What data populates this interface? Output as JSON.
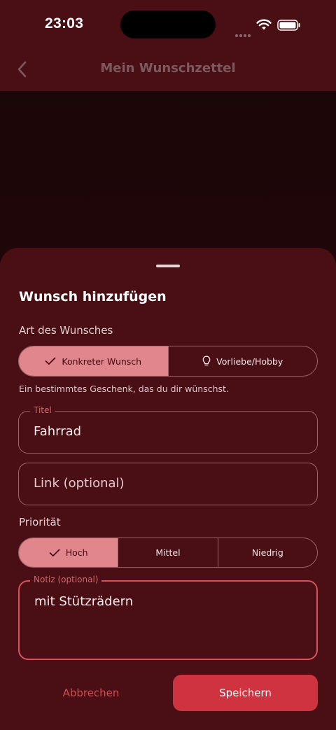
{
  "status": {
    "time": "23:03"
  },
  "nav": {
    "title": "Mein Wunschzettel"
  },
  "sheet": {
    "title": "Wunsch hinzufügen",
    "type_label": "Art des Wunsches",
    "type_options": [
      {
        "label": "Konkreter Wunsch",
        "selected": true,
        "icon": "check-icon"
      },
      {
        "label": "Vorliebe/Hobby",
        "selected": false,
        "icon": "lightbulb-icon"
      }
    ],
    "type_helper": "Ein bestimmtes Geschenk, das du dir wünschst.",
    "title_field": {
      "label": "Titel",
      "value": "Fahrrad"
    },
    "link_field": {
      "placeholder": "Link (optional)"
    },
    "priority_label": "Priorität",
    "priority_options": [
      {
        "label": "Hoch",
        "selected": true
      },
      {
        "label": "Mittel",
        "selected": false
      },
      {
        "label": "Niedrig",
        "selected": false
      }
    ],
    "note_field": {
      "label": "Notiz (optional)",
      "value": "mit Stützrädern"
    },
    "cancel_label": "Abbrechen",
    "save_label": "Speichern"
  },
  "colors": {
    "sheet_bg": "#4a0f14",
    "selected_segment": "#e0868c",
    "primary_button": "#cf3340",
    "accent_text": "#d24a53"
  }
}
